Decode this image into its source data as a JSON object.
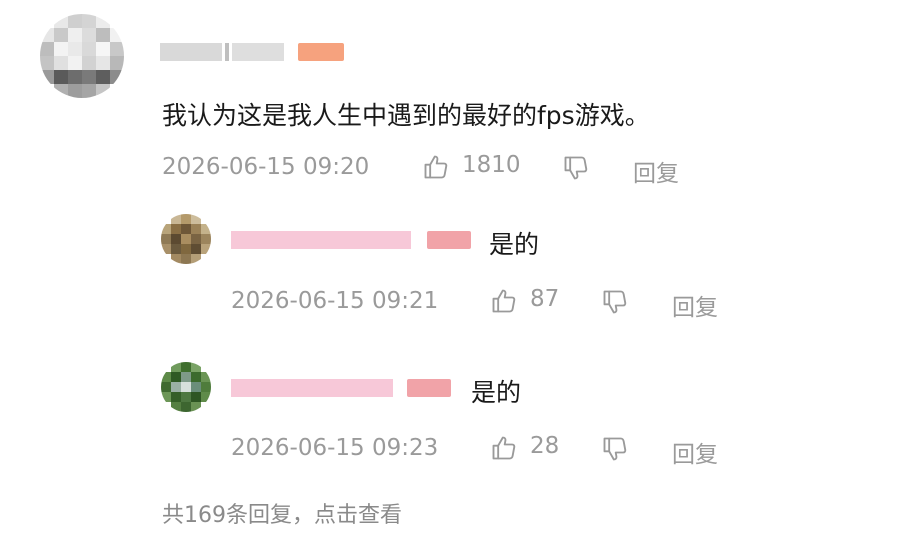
{
  "colors": {
    "text": "#1a1a1a",
    "meta": "#9a9a9a",
    "name_blur": "#d8d8d8",
    "badge_orange": "#f6a27e",
    "badge_pink": "#f1a3a8",
    "name_pink": "#f7c5d6"
  },
  "main_comment": {
    "text": "我认为这是我人生中遇到的最好的fps游戏。",
    "timestamp": "2026-06-15 09:20",
    "likes": "1810",
    "reply_label": "回复",
    "like_icon": "thumbs-up-icon",
    "dislike_icon": "thumbs-down-icon"
  },
  "replies": [
    {
      "text": "是的",
      "timestamp": "2026-06-15 09:21",
      "likes": "87",
      "reply_label": "回复"
    },
    {
      "text": "是的",
      "timestamp": "2026-06-15 09:23",
      "likes": "28",
      "reply_label": "回复"
    }
  ],
  "more_replies": "共169条回复，点击查看"
}
